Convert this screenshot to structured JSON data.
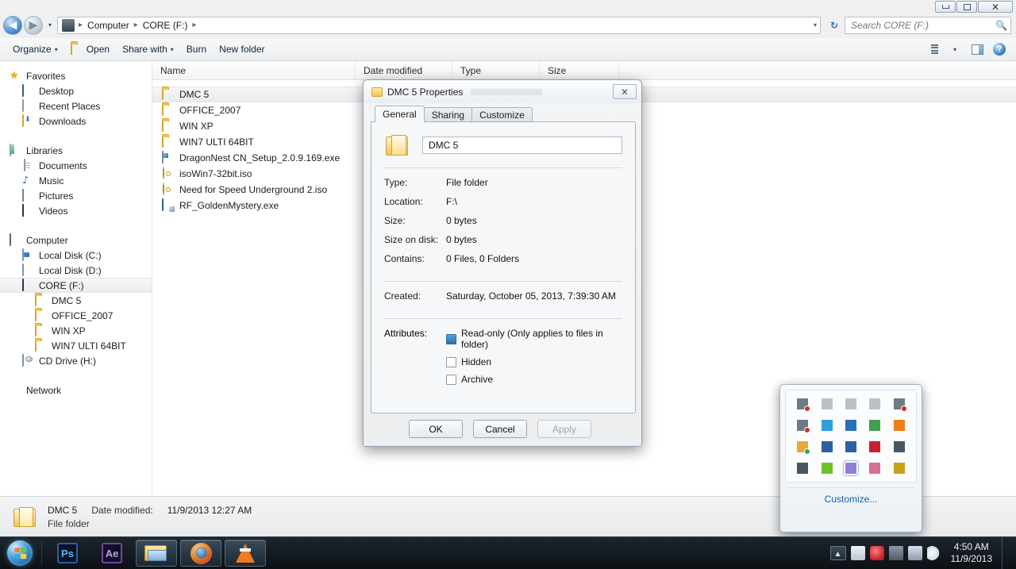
{
  "window": {
    "controls": {
      "minimize": "–",
      "maximize": "□",
      "close": "✕"
    }
  },
  "address": {
    "back_icon": "◀",
    "forward_icon": "▶",
    "history_caret": "▾",
    "crumbs": [
      "Computer",
      "CORE (F:)"
    ],
    "separator": "▸",
    "crumb_dropdown": "▾",
    "refresh_icon": "↻"
  },
  "search": {
    "placeholder": "Search CORE (F:)",
    "icon": "search-icon"
  },
  "toolbar": {
    "organize": "Organize",
    "open": "Open",
    "share_with": "Share with",
    "burn": "Burn",
    "new_folder": "New folder",
    "caret": "▾",
    "help_glyph": "?"
  },
  "sidebar": {
    "groups": [
      {
        "header": {
          "label": "Favorites",
          "icon": "star-icon"
        },
        "items": [
          {
            "label": "Desktop",
            "icon": "desktop-icon"
          },
          {
            "label": "Recent Places",
            "icon": "recent-places-icon"
          },
          {
            "label": "Downloads",
            "icon": "downloads-icon"
          }
        ]
      },
      {
        "header": {
          "label": "Libraries",
          "icon": "libraries-icon"
        },
        "items": [
          {
            "label": "Documents",
            "icon": "document-icon"
          },
          {
            "label": "Music",
            "icon": "music-note-icon"
          },
          {
            "label": "Pictures",
            "icon": "picture-icon"
          },
          {
            "label": "Videos",
            "icon": "video-icon"
          }
        ]
      },
      {
        "header": {
          "label": "Computer",
          "icon": "computer-icon"
        },
        "items": [
          {
            "label": "Local Disk (C:)",
            "icon": "hard-disk-windows-icon"
          },
          {
            "label": "Local Disk (D:)",
            "icon": "hard-disk-icon"
          },
          {
            "label": "CORE (F:)",
            "icon": "removable-drive-icon",
            "selected": true
          },
          {
            "label": "DMC 5",
            "icon": "folder-icon",
            "level": 2
          },
          {
            "label": "OFFICE_2007",
            "icon": "folder-icon",
            "level": 2
          },
          {
            "label": "WIN XP",
            "icon": "folder-icon",
            "level": 2
          },
          {
            "label": "WIN7 ULTI 64BIT",
            "icon": "folder-icon",
            "level": 2
          },
          {
            "label": "CD Drive (H:)",
            "icon": "cd-drive-icon"
          }
        ]
      },
      {
        "header": {
          "label": "Network",
          "icon": "network-icon"
        },
        "items": []
      }
    ]
  },
  "filelist": {
    "columns": [
      "Name",
      "Date modified",
      "Type",
      "Size"
    ],
    "rows": [
      {
        "name": "DMC 5",
        "icon": "folder-icon",
        "selected": true
      },
      {
        "name": "OFFICE_2007",
        "icon": "folder-icon"
      },
      {
        "name": "WIN XP",
        "icon": "folder-icon"
      },
      {
        "name": "WIN7 ULTI 64BIT",
        "icon": "folder-icon"
      },
      {
        "name": "DragonNest CN_Setup_2.0.9.169.exe",
        "icon": "exe-icon"
      },
      {
        "name": "isoWin7-32bit.iso",
        "icon": "iso-disc-icon"
      },
      {
        "name": "Need for Speed Underground 2.iso",
        "icon": "iso-disc-icon"
      },
      {
        "name": "RF_GoldenMystery.exe",
        "icon": "exe-app-icon"
      }
    ]
  },
  "details": {
    "name": "DMC 5",
    "date_modified_label": "Date modified:",
    "date_modified_value": "11/9/2013 12:27 AM",
    "type": "File folder"
  },
  "properties_dialog": {
    "title": "DMC 5 Properties",
    "close_glyph": "✕",
    "tabs": [
      {
        "label": "General",
        "active": true
      },
      {
        "label": "Sharing",
        "active": false
      },
      {
        "label": "Customize",
        "active": false
      }
    ],
    "name_value": "DMC 5",
    "rows": [
      {
        "key": "Type:",
        "value": "File folder"
      },
      {
        "key": "Location:",
        "value": "F:\\"
      },
      {
        "key": "Size:",
        "value": "0 bytes"
      },
      {
        "key": "Size on disk:",
        "value": "0 bytes"
      },
      {
        "key": "Contains:",
        "value": "0 Files, 0 Folders"
      }
    ],
    "created_key": "Created:",
    "created_value": "Saturday, October 05, 2013, 7:39:30 AM",
    "attributes_key": "Attributes:",
    "attributes": [
      {
        "label": "Read-only (Only applies to files in folder)",
        "state": "filled"
      },
      {
        "label": "Hidden",
        "state": "unchecked"
      },
      {
        "label": "Archive",
        "state": "unchecked"
      }
    ],
    "buttons": [
      {
        "label": "OK",
        "disabled": false
      },
      {
        "label": "Cancel",
        "disabled": false
      },
      {
        "label": "Apply",
        "disabled": true
      }
    ]
  },
  "tray_popup": {
    "customize_label": "Customize...",
    "icons": [
      {
        "name": "network-disconnected-icon",
        "color": "#6d7b86",
        "badge": "#d42c2c"
      },
      {
        "name": "network-inactive-icon",
        "color": "#b9c2c9",
        "badge": ""
      },
      {
        "name": "network-inactive-2-icon",
        "color": "#b9c2c9",
        "badge": ""
      },
      {
        "name": "network-inactive-3-icon",
        "color": "#b9c2c9",
        "badge": ""
      },
      {
        "name": "network-disconnected-2-icon",
        "color": "#6d7b86",
        "badge": "#d42c2c"
      },
      {
        "name": "network-disconnected-3-icon",
        "color": "#6d7b86",
        "badge": "#d42c2c"
      },
      {
        "name": "wireless-console-icon",
        "color": "#2f9fe0",
        "badge": ""
      },
      {
        "name": "3d-settings-icon",
        "color": "#2d6fb5",
        "badge": ""
      },
      {
        "name": "globe-money-icon",
        "color": "#3f9f55",
        "badge": ""
      },
      {
        "name": "vlc-cone-icon",
        "color": "#f07c1e",
        "badge": ""
      },
      {
        "name": "sync-icon",
        "color": "#e8a93a",
        "badge": "#3fa34d"
      },
      {
        "name": "display-graph-icon",
        "color": "#2f5fa0",
        "badge": ""
      },
      {
        "name": "display-graph-2-icon",
        "color": "#2f5fa0",
        "badge": ""
      },
      {
        "name": "adobe-icon",
        "color": "#c8202c",
        "badge": ""
      },
      {
        "name": "headphones-icon",
        "color": "#4a5562",
        "badge": ""
      },
      {
        "name": "monitor-icon",
        "color": "#4a5562",
        "badge": ""
      },
      {
        "name": "nvidia-icon",
        "color": "#6fbf2a",
        "badge": ""
      },
      {
        "name": "pen-tool-icon",
        "color": "#8f7fd8",
        "badge": "",
        "selected": true
      },
      {
        "name": "avatar-icon",
        "color": "#d86f8f",
        "badge": ""
      },
      {
        "name": "power-icon",
        "color": "#c8a21a",
        "badge": ""
      }
    ]
  },
  "taskbar": {
    "start_label": "Start",
    "buttons": [
      {
        "name": "photoshop",
        "label": "Ps"
      },
      {
        "name": "after-effects",
        "label": "Ae"
      },
      {
        "name": "explorer",
        "label": "",
        "running": true
      },
      {
        "name": "firefox",
        "label": "",
        "running": true
      },
      {
        "name": "vlc",
        "label": "",
        "running": true
      }
    ],
    "tray_expander": "▲",
    "tray_icons": [
      {
        "name": "action-center-icon",
        "color": "#d8dde2",
        "badge": "#3fa34d"
      },
      {
        "name": "power-plug-icon",
        "color": "#c8202c",
        "badge": ""
      },
      {
        "name": "network-error-icon",
        "color": "#6d7b86",
        "badge": "#d42c2c"
      },
      {
        "name": "monitor-tray-icon",
        "color": "#aab6c2",
        "badge": ""
      },
      {
        "name": "volume-icon",
        "color": "#e8eef4",
        "badge": ""
      }
    ],
    "clock_time": "4:50 AM",
    "clock_date": "11/9/2013"
  }
}
